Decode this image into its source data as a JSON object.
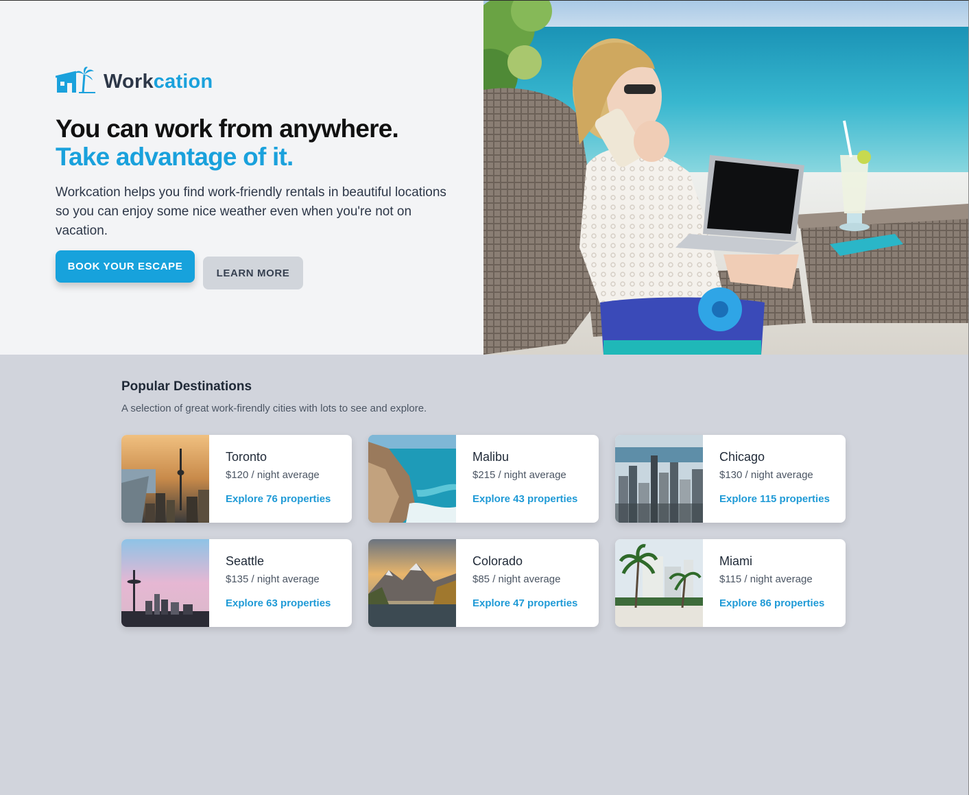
{
  "brand": {
    "name_part1": "Work",
    "name_part2": "cation",
    "accent": "#1aa1dc"
  },
  "hero": {
    "headline_line1": "You can work from anywhere.",
    "headline_line2": "Take advantage of it.",
    "lead": "Workcation helps you find work-friendly rentals in beautiful locations so you can enjoy some nice weather even when you're not on vacation.",
    "primary_button": "BOOK YOUR ESCAPE",
    "secondary_button": "LEARN MORE",
    "image_icon": "beach-laptop-photo"
  },
  "popular": {
    "title": "Popular Destinations",
    "subtitle": "A selection of great work-firendly cities with lots to see and explore."
  },
  "destinations": [
    {
      "city": "Toronto",
      "price": "$120 / night average",
      "link": "Explore 76 properties"
    },
    {
      "city": "Malibu",
      "price": "$215 / night average",
      "link": "Explore 43 properties"
    },
    {
      "city": "Chicago",
      "price": "$130 / night average",
      "link": "Explore 115 properties"
    },
    {
      "city": "Seattle",
      "price": "$135 / night average",
      "link": "Explore 63 properties"
    },
    {
      "city": "Colorado",
      "price": "$85 / night average",
      "link": "Explore 47 properties"
    },
    {
      "city": "Miami",
      "price": "$115 / night average",
      "link": "Explore 86 properties"
    }
  ]
}
